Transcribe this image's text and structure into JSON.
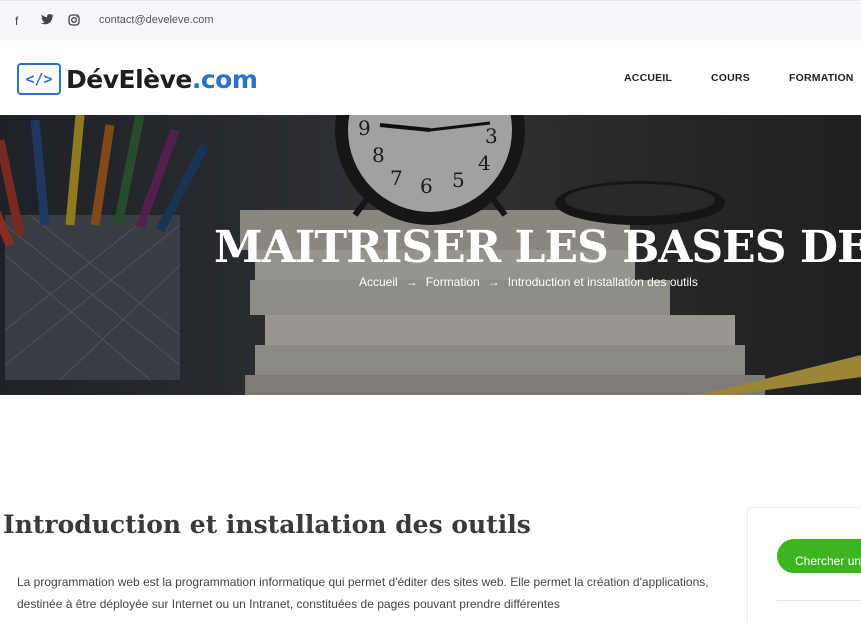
{
  "topbar": {
    "social": [
      {
        "name": "facebook-icon",
        "glyph": "f"
      },
      {
        "name": "twitter-icon",
        "glyph": "🐦"
      },
      {
        "name": "instagram-icon",
        "glyph": "◎"
      }
    ],
    "email": "contact@develeve.com"
  },
  "header": {
    "logo_icon": "</>",
    "logo_dark": "DévElève",
    "logo_blue": ".com",
    "nav": [
      "ACCUEIL",
      "COURS",
      "FORMATION"
    ]
  },
  "hero": {
    "title": "MAITRISER LES BASES DE PHP",
    "breadcrumb": [
      "Accueil",
      "Formation",
      "Introduction et installation des outils"
    ],
    "arrow": "→"
  },
  "content": {
    "title": "Introduction et installation des outils",
    "paragraph": "La programmation web est la programmation informatique qui permet d'éditer des sites web. Elle permet la création d'applications, destinée à être déployée sur Internet ou un Intranet, constituées de pages pouvant prendre différentes"
  },
  "sidebar": {
    "search_label": "Chercher un cours"
  },
  "colors": {
    "brand_blue": "#2a73c6",
    "accent_green": "#3cb521"
  }
}
